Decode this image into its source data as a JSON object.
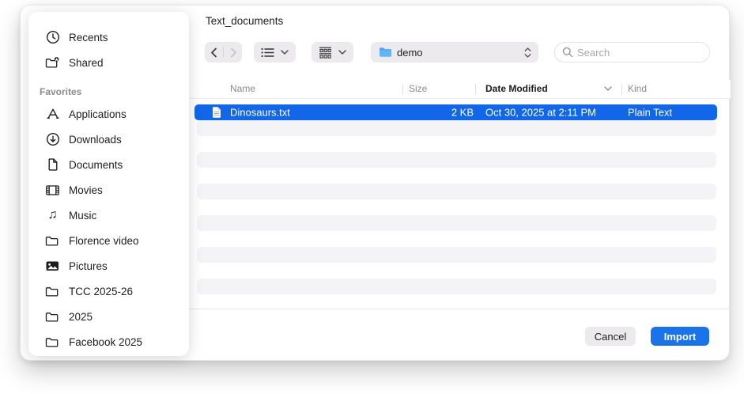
{
  "window_title": "Text_documents",
  "sidebar": {
    "top_items": [
      {
        "icon": "clock",
        "label": "Recents"
      },
      {
        "icon": "shared-folder",
        "label": "Shared"
      }
    ],
    "section_label": "Favorites",
    "favorites": [
      {
        "icon": "app-store",
        "label": "Applications"
      },
      {
        "icon": "download-circle",
        "label": "Downloads"
      },
      {
        "icon": "document",
        "label": "Documents"
      },
      {
        "icon": "film",
        "label": "Movies"
      },
      {
        "icon": "music-note",
        "label": "Music"
      },
      {
        "icon": "folder",
        "label": "Florence video"
      },
      {
        "icon": "photo",
        "label": "Pictures"
      },
      {
        "icon": "folder",
        "label": "TCC 2025-26"
      },
      {
        "icon": "folder",
        "label": "2025"
      },
      {
        "icon": "folder",
        "label": "Facebook 2025"
      }
    ]
  },
  "toolbar": {
    "location": "demo",
    "search_placeholder": "Search"
  },
  "table": {
    "columns": [
      "Name",
      "Size",
      "Date Modified",
      "Kind"
    ],
    "sorted_column": "Date Modified",
    "rows": [
      {
        "name": "Dinosaurs.txt",
        "size": "2 KB",
        "date_modified": "Oct 30, 2025 at 2:11 PM",
        "kind": "Plain Text",
        "selected": true
      }
    ],
    "empty_row_count": 12
  },
  "footer": {
    "cancel_label": "Cancel",
    "import_label": "Import"
  },
  "colors": {
    "selection_blue": "#1267e8",
    "import_blue": "#1a73e8",
    "folder_blue": "#4ba3f2",
    "stripe_gray": "#f4f4f6"
  }
}
